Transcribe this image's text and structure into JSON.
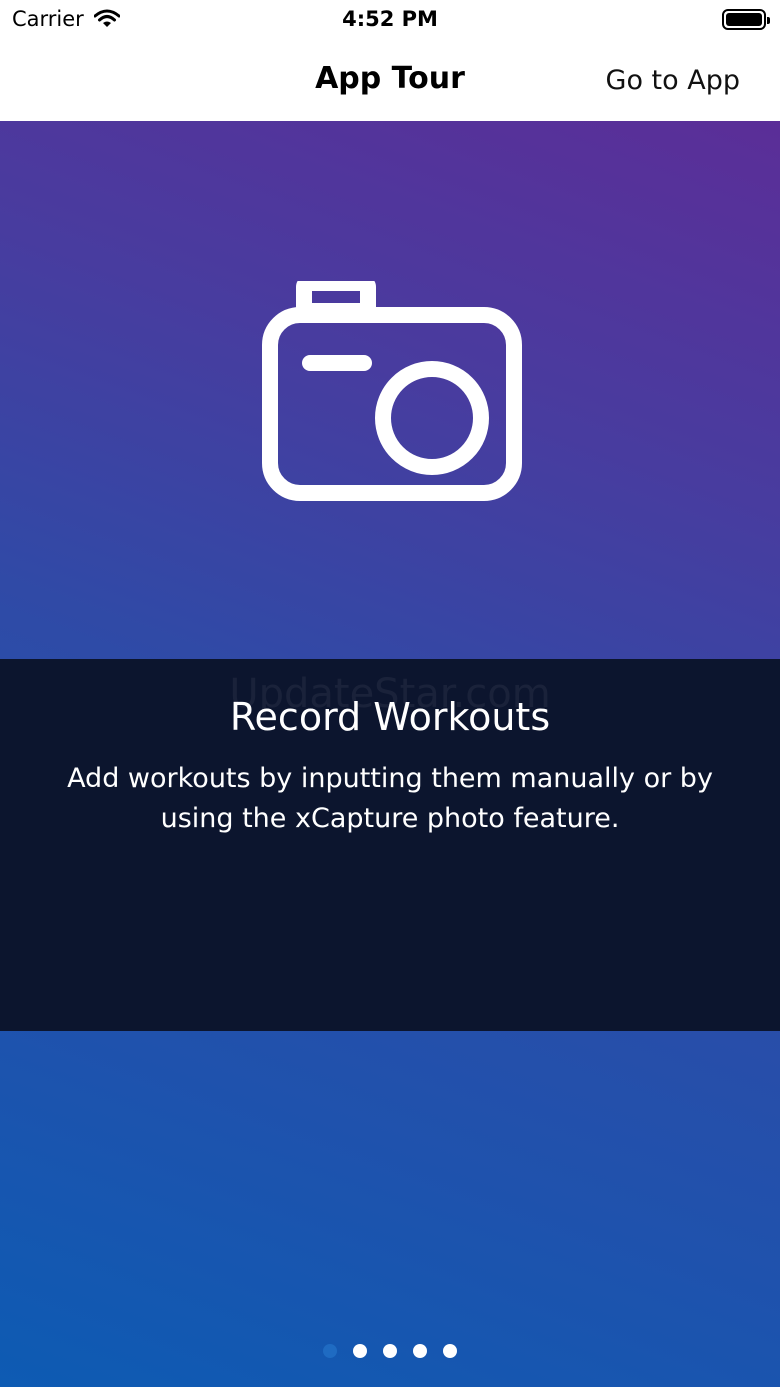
{
  "status_bar": {
    "carrier": "Carrier",
    "time": "4:52 PM",
    "battery_level": 1.0
  },
  "nav": {
    "title": "App Tour",
    "action_label": "Go to App"
  },
  "slide": {
    "icon": "camera-icon",
    "watermark": "UpdateStar.com",
    "title": "Record Workouts",
    "description": "Add workouts by inputting them manually or by using the xCapture photo feature."
  },
  "pager": {
    "total": 5,
    "current": 1
  },
  "colors": {
    "gradient_top": "#5b2e98",
    "gradient_bottom": "#0d5bb3",
    "panel": "#0c152e",
    "dot_active": "#1f6bc2"
  }
}
